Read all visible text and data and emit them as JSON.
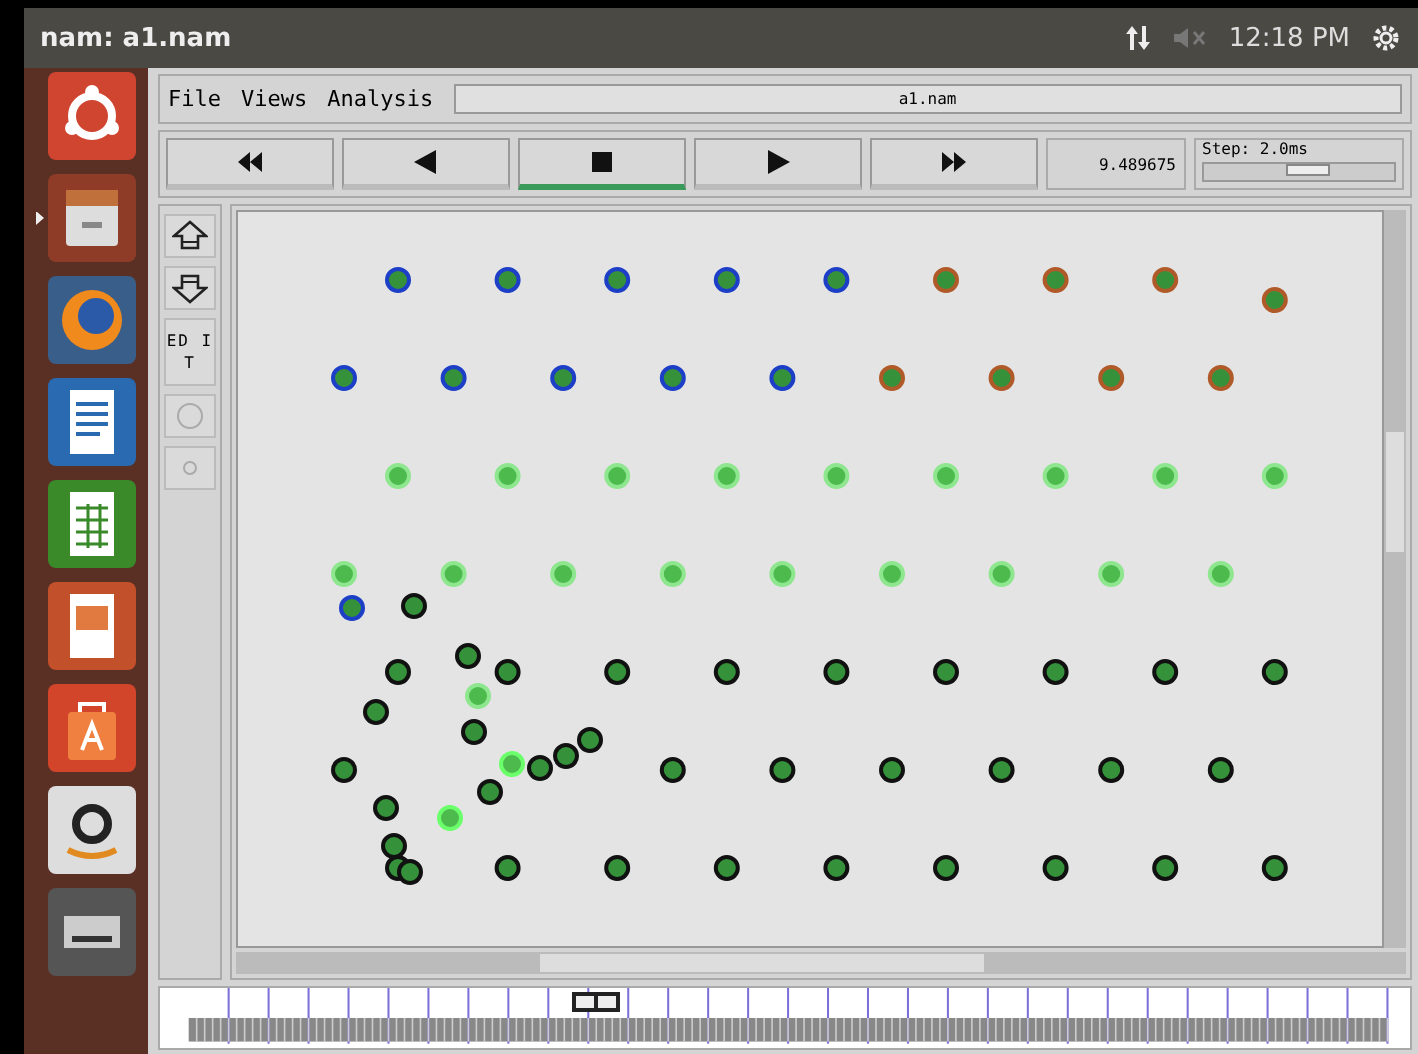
{
  "top_bar": {
    "title": "nam: a1.nam",
    "clock": "12:18 PM"
  },
  "launcher": {
    "items": [
      {
        "kind": "ubuntu",
        "selected": false
      },
      {
        "kind": "files",
        "selected": true
      },
      {
        "kind": "firefox",
        "selected": false
      },
      {
        "kind": "writer",
        "selected": false
      },
      {
        "kind": "calc",
        "selected": false
      },
      {
        "kind": "impress",
        "selected": false
      },
      {
        "kind": "software",
        "selected": false
      },
      {
        "kind": "amazon",
        "selected": false
      },
      {
        "kind": "drive",
        "selected": false
      }
    ]
  },
  "menu": [
    "File",
    "Views",
    "Analysis"
  ],
  "file_field": "a1.nam",
  "controls": [
    {
      "kind": "rewind",
      "selected": false
    },
    {
      "kind": "back",
      "selected": false
    },
    {
      "kind": "stop",
      "selected": true
    },
    {
      "kind": "play",
      "selected": false
    },
    {
      "kind": "forward",
      "selected": false
    }
  ],
  "time": "9.489675",
  "step": {
    "label": "Step: 2.0ms",
    "level": 0.55
  },
  "tools": [
    {
      "kind": "zoom-in"
    },
    {
      "kind": "zoom-out"
    },
    {
      "kind": "edit",
      "label": "ED IT"
    },
    {
      "kind": "circle"
    },
    {
      "kind": "dot"
    }
  ],
  "canvas": {
    "rows": [
      {
        "nodes": [
          {
            "color": "#1d3fc8"
          },
          {
            "color": "#1d3fc8"
          },
          {
            "color": "#1d3fc8"
          },
          {
            "color": "#1d3fc8"
          },
          {
            "color": "#1d3fc8"
          },
          {
            "color": "#b05a2a"
          },
          {
            "color": "#b05a2a"
          },
          {
            "color": "#b05a2a"
          },
          {
            "color": "#b05a2a"
          }
        ]
      },
      {
        "nodes": [
          {
            "color": "#1d3fc8"
          },
          {
            "color": "#1d3fc8"
          },
          {
            "color": "#1d3fc8"
          },
          {
            "color": "#1d3fc8"
          },
          {
            "color": "#1d3fc8"
          },
          {
            "color": "#b05a2a"
          },
          {
            "color": "#b05a2a"
          },
          {
            "color": "#b05a2a"
          },
          {
            "color": "#b05a2a"
          }
        ]
      },
      {
        "nodes": [
          {
            "color": "#8ee68e"
          },
          {
            "color": "#8ee68e"
          },
          {
            "color": "#8ee68e"
          },
          {
            "color": "#8ee68e"
          },
          {
            "color": "#8ee68e"
          },
          {
            "color": "#8ee68e"
          },
          {
            "color": "#8ee68e"
          },
          {
            "color": "#8ee68e"
          },
          {
            "color": "#8ee68e"
          }
        ]
      },
      {
        "nodes": [
          {
            "color": "#8ee68e"
          },
          {
            "color": "#8ee68e"
          },
          {
            "color": "#8ee68e"
          },
          {
            "color": "#8ee68e"
          },
          {
            "color": "#8ee68e"
          },
          {
            "color": "#8ee68e"
          },
          {
            "color": "#8ee68e"
          },
          {
            "color": "#8ee68e"
          },
          {
            "color": "#8ee68e"
          }
        ]
      },
      {
        "nodes": [
          {
            "color": "#111111"
          },
          {
            "color": "#111111"
          },
          {
            "color": "#111111"
          },
          {
            "color": "#111111"
          },
          {
            "color": "#111111"
          },
          {
            "color": "#111111"
          },
          {
            "color": "#111111"
          },
          {
            "color": "#111111"
          },
          {
            "color": "#111111"
          }
        ]
      },
      {
        "nodes": [
          {
            "color": "#111111"
          },
          {
            "color": "#111111"
          },
          {
            "color": "#111111"
          },
          {
            "color": "#111111"
          },
          {
            "color": "#111111"
          },
          {
            "color": "#111111"
          },
          {
            "color": "#111111"
          }
        ]
      },
      {
        "nodes": [
          {
            "color": "#111111"
          },
          {
            "color": "#111111"
          },
          {
            "color": "#111111"
          },
          {
            "color": "#111111"
          },
          {
            "color": "#111111"
          },
          {
            "color": "#111111"
          },
          {
            "color": "#111111"
          },
          {
            "color": "#111111"
          },
          {
            "color": "#111111"
          }
        ]
      }
    ],
    "moving_nodes": [
      {
        "color": "#1d3fc8"
      },
      {
        "color": "#111111"
      },
      {
        "color": "#111111"
      },
      {
        "color": "#8ee68e"
      },
      {
        "color": "#111111"
      },
      {
        "color": "#111111"
      },
      {
        "color": "#6cff6c"
      },
      {
        "color": "#111111"
      },
      {
        "color": "#111111"
      },
      {
        "color": "#111111"
      },
      {
        "color": "#111111"
      },
      {
        "color": "#111111"
      },
      {
        "color": "#6cff6c"
      },
      {
        "color": "#111111"
      },
      {
        "color": "#111111"
      }
    ]
  }
}
